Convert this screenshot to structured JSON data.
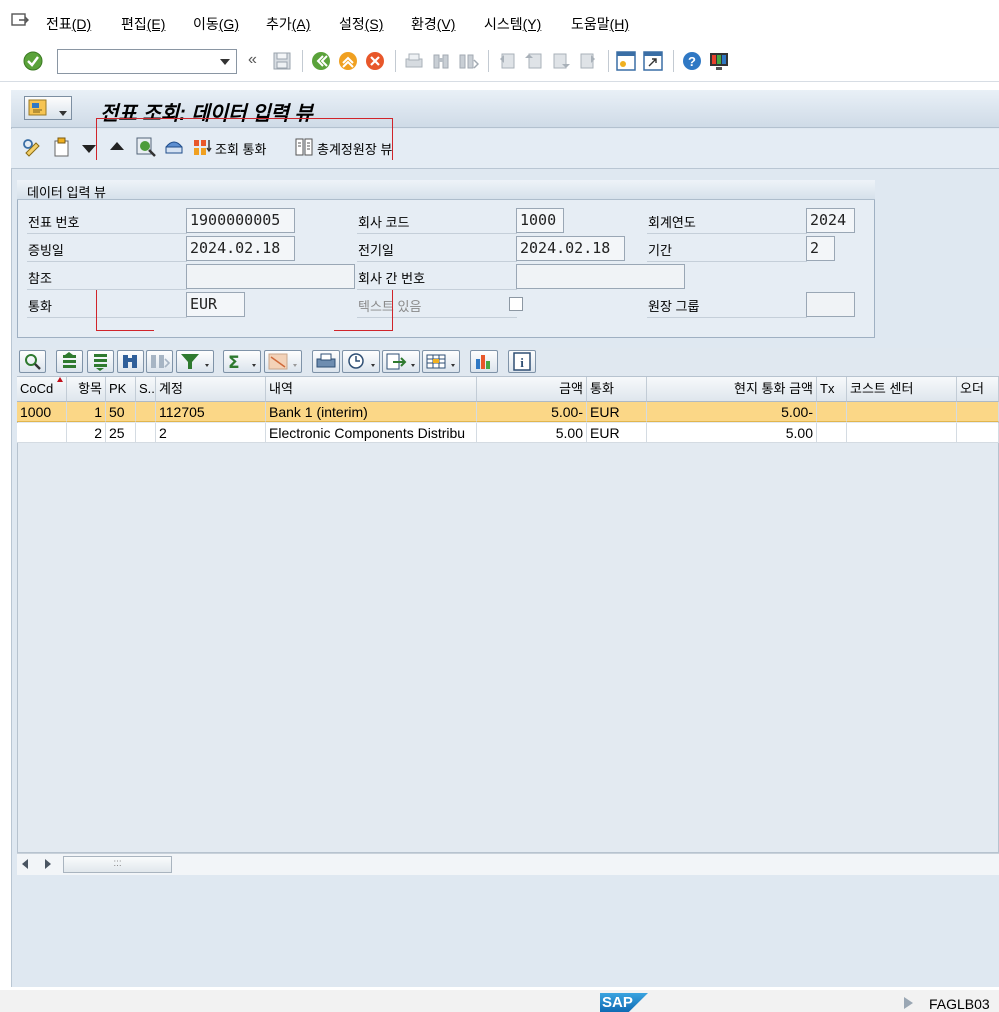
{
  "menu": {
    "items": [
      {
        "label": "전표",
        "key": "(D)"
      },
      {
        "label": "편집",
        "key": "(E)"
      },
      {
        "label": "이동",
        "key": "(G)"
      },
      {
        "label": "추가",
        "key": "(A)"
      },
      {
        "label": "설정",
        "key": "(S)"
      },
      {
        "label": "환경",
        "key": "(V)"
      },
      {
        "label": "시스템",
        "key": "(Y)"
      },
      {
        "label": "도움말",
        "key": "(H)"
      }
    ]
  },
  "command_field": {
    "value": "",
    "placeholder": ""
  },
  "title": "전표 조회: 데이터 입력 뷰",
  "app_toolbar": {
    "display_currency": "조회 통화",
    "ledger_view": "총계정원장 뷰"
  },
  "header": {
    "group_title": "데이터 입력 뷰",
    "doc_number_label": "전표 번호",
    "doc_number": "1900000005",
    "company_code_label": "회사 코드",
    "company_code": "1000",
    "fiscal_year_label": "회계연도",
    "fiscal_year": "2024",
    "doc_date_label": "증빙일",
    "doc_date": "2024.02.18",
    "posting_date_label": "전기일",
    "posting_date": "2024.02.18",
    "period_label": "기간",
    "period": "2",
    "reference_label": "참조",
    "reference": "",
    "intercompany_label": "회사 간 번호",
    "intercompany": "",
    "currency_label": "통화",
    "currency": "EUR",
    "text_exists_label": "텍스트 있음",
    "ledger_group_label": "원장 그룹",
    "ledger_group": ""
  },
  "grid": {
    "columns": [
      "CoCd",
      "항목",
      "PK",
      "S...",
      "계정",
      "내역",
      "금액",
      "통화",
      "현지 통화 금액",
      "Tx",
      "코스트 센터",
      "오더"
    ],
    "rows": [
      {
        "cocd": "1000",
        "item": "1",
        "pk": "50",
        "s": "",
        "account": "112705",
        "text": "Bank 1 (interim)",
        "amount": "5.00-",
        "currency": "EUR",
        "local_amount": "5.00-",
        "tx": "",
        "cost_center": "",
        "order": ""
      },
      {
        "cocd": "",
        "item": "2",
        "pk": "25",
        "s": "",
        "account": "2",
        "text": "Electronic Components Distribu",
        "amount": "5.00",
        "currency": "EUR",
        "local_amount": "5.00",
        "tx": "",
        "cost_center": "",
        "order": ""
      }
    ]
  },
  "status": {
    "logo": "SAP",
    "tcode": "FAGLB03"
  }
}
